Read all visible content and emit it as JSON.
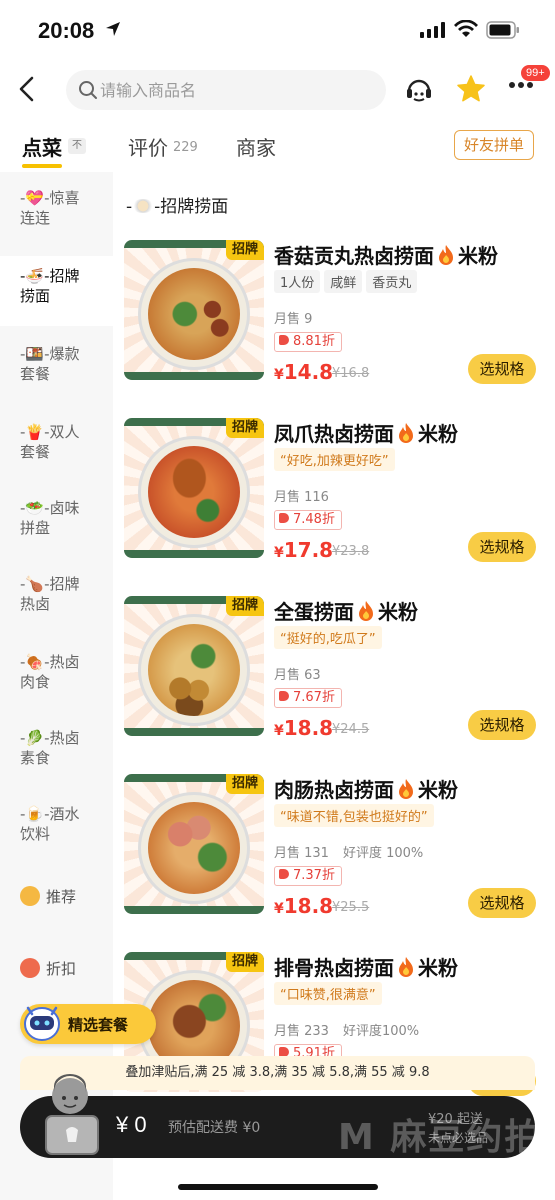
{
  "status_bar": {
    "time": "20:08"
  },
  "header": {
    "search_placeholder": "请输入商品名",
    "more_badge": "99+"
  },
  "tabs": {
    "order": "点菜",
    "pin": "不",
    "review": "评价",
    "review_count": "229",
    "merchant": "商家",
    "group_order": "好友拼单"
  },
  "sidebar": {
    "items": [
      {
        "line1": "-💝-惊喜",
        "line2": "连连"
      },
      {
        "line1": "-🍜-招牌",
        "line2": "捞面"
      },
      {
        "line1": "-🍱-爆款",
        "line2": "套餐"
      },
      {
        "line1": "-🍟-双人",
        "line2": "套餐"
      },
      {
        "line1": "-🥗-卤味",
        "line2": "拼盘"
      },
      {
        "line1": "-🍗-招牌",
        "line2": "热卤"
      },
      {
        "line1": "-🍖-热卤",
        "line2": "肉食"
      },
      {
        "line1": "-🥬-热卤",
        "line2": "素食"
      },
      {
        "line1": "-🍺-酒水",
        "line2": "饮料"
      }
    ],
    "recommend": "推荐",
    "discount": "折扣"
  },
  "section": {
    "title": "-招牌捞面"
  },
  "products": [
    {
      "badge": "招牌",
      "name_pre": "香菇贡丸热卤捞面",
      "name_post": "米粉",
      "tags": [
        "1人份",
        "咸鲜",
        "香贡丸"
      ],
      "sales": "月售 9",
      "rating": "",
      "discount": "8.81折",
      "currency": "¥",
      "price": "14.8",
      "original_price": "¥16.8",
      "button": "选规格"
    },
    {
      "badge": "招牌",
      "name_pre": "凤爪热卤捞面",
      "name_post": "米粉",
      "quote": "“好吃,加辣更好吃”",
      "sales": "月售 116",
      "rating": "",
      "discount": "7.48折",
      "currency": "¥",
      "price": "17.8",
      "original_price": "¥23.8",
      "button": "选规格"
    },
    {
      "badge": "招牌",
      "name_pre": "全蛋捞面",
      "name_post": "米粉",
      "quote": "“挺好的,吃瓜了”",
      "sales": "月售 63",
      "rating": "",
      "discount": "7.67折",
      "currency": "¥",
      "price": "18.8",
      "original_price": "¥24.5",
      "button": "选规格"
    },
    {
      "badge": "招牌",
      "name_pre": "肉肠热卤捞面",
      "name_post": "米粉",
      "quote": "“味道不错,包装也挺好的”",
      "sales": "月售 131",
      "rating": "好评度 100%",
      "discount": "7.37折",
      "currency": "¥",
      "price": "18.8",
      "original_price": "¥25.5",
      "button": "选规格"
    },
    {
      "badge": "招牌",
      "name_pre": "排骨热卤捞面",
      "name_post": "米粉",
      "quote": "“口味赞,很满意”",
      "sales": "月售 233",
      "rating": "好评度100%",
      "discount": "5.91折",
      "currency": "¥",
      "price": "",
      "original_price": "",
      "button": "选规格"
    }
  ],
  "floating": {
    "combo_label": "精选套餐"
  },
  "promo": {
    "text": "叠加津贴后,满 25 减 3.8,满 35 减 5.8,满 55 减 9.8"
  },
  "cart": {
    "amount": "¥ 0",
    "delivery": "预估配送费 ¥0",
    "min_order": "¥20 起送",
    "required": "未点必选品"
  },
  "watermark": "M 麻豆约拍",
  "colors": {
    "accent_yellow": "#f8cc45",
    "price_red": "#f03a2e",
    "badge_yellow": "#f6c511",
    "cart_dark": "#1c1c1c"
  }
}
